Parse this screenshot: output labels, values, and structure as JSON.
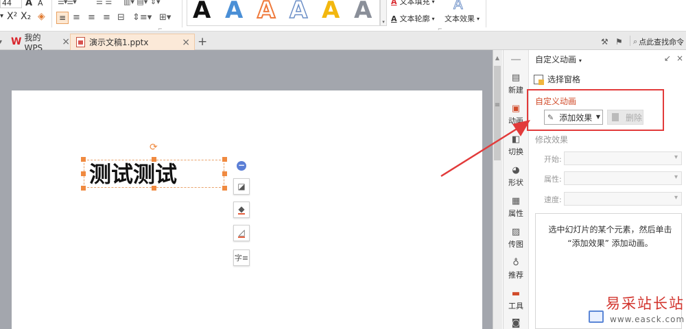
{
  "ribbon": {
    "font_size": "44",
    "bold_a": "A",
    "font_a": "A",
    "superscript": "X²",
    "subscript": "X₂",
    "wordart_samples": [
      {
        "glyph": "A",
        "color": "#111111",
        "style": "solid"
      },
      {
        "glyph": "A",
        "color": "#4a8fd6",
        "style": "solid"
      },
      {
        "glyph": "A",
        "color": "#ef7a3c",
        "style": "outline"
      },
      {
        "glyph": "A",
        "color": "#6c8fc7",
        "style": "outline"
      },
      {
        "glyph": "A",
        "color": "#f2b70f",
        "style": "solid"
      },
      {
        "glyph": "A",
        "color": "#8a8f99",
        "style": "gradient"
      }
    ],
    "text_fill": "文本填充",
    "text_outline": "文本轮廓",
    "text_effect": "文本效果"
  },
  "tabs": [
    {
      "label": "我的WPS",
      "icon": "wps-logo",
      "active": false
    },
    {
      "label": "演示文稿1.pptx",
      "icon": "pptx-file-icon",
      "active": true
    }
  ],
  "tabbar_right": {
    "search_label": "点此查找命令"
  },
  "slide": {
    "text": "测试测试"
  },
  "rail": [
    {
      "label": "新建",
      "icon": "file-new-icon"
    },
    {
      "label": "动画",
      "icon": "animation-icon",
      "active": true
    },
    {
      "label": "切换",
      "icon": "transition-icon"
    },
    {
      "label": "形状",
      "icon": "shape-icon"
    },
    {
      "label": "属性",
      "icon": "properties-icon"
    },
    {
      "label": "传图",
      "icon": "upload-image-icon"
    },
    {
      "label": "推荐",
      "icon": "recommend-icon"
    },
    {
      "label": "工具",
      "icon": "toolbox-icon"
    }
  ],
  "panel": {
    "title": "自定义动画",
    "selection_pane": "选择窗格",
    "section_title": "自定义动画",
    "add_effect": "添加效果",
    "delete": "删除",
    "modify_title": "修改效果",
    "fields": [
      {
        "label": "开始:"
      },
      {
        "label": "属性:"
      },
      {
        "label": "速度:"
      }
    ],
    "hint": "选中幻灯片的某个元素，然后单击 “添加效果” 添加动画。"
  },
  "colors": {
    "accent_orange": "#d14b2a",
    "highlight_red": "#e23a3a",
    "handle_orange": "#f08a40"
  },
  "watermark": {
    "line1": "易采站长站",
    "line2": "www.easck.com"
  }
}
